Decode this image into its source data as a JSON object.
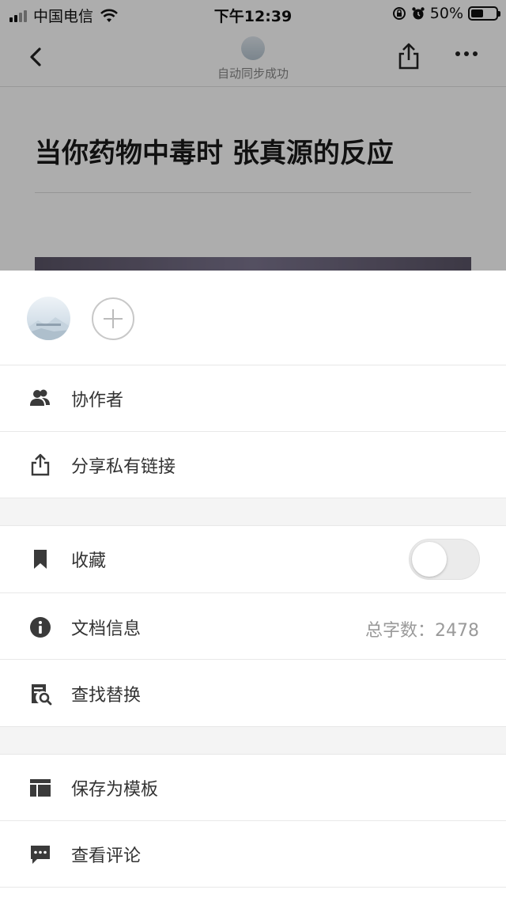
{
  "status_bar": {
    "carrier": "中国电信",
    "time": "下午12:39",
    "battery": "50%"
  },
  "nav": {
    "sync_status": "自动同步成功"
  },
  "document": {
    "title": "当你药物中毒时 张真源的反应"
  },
  "menu": {
    "collaborators": "协作者",
    "share_private_link": "分享私有链接",
    "favorite": "收藏",
    "favorite_on": false,
    "doc_info": "文档信息",
    "word_count_label": "总字数：",
    "word_count": "2478",
    "find_replace": "查找替换",
    "save_as_template": "保存为模板",
    "view_comments": "查看评论"
  },
  "icons": {
    "back": "chevron-left-icon",
    "share": "share-icon",
    "more": "more-icon",
    "collaborators": "users-icon",
    "share_link": "share-icon",
    "favorite": "bookmark-icon",
    "info": "info-icon",
    "find": "find-document-icon",
    "template": "template-icon",
    "comments": "comment-icon"
  }
}
